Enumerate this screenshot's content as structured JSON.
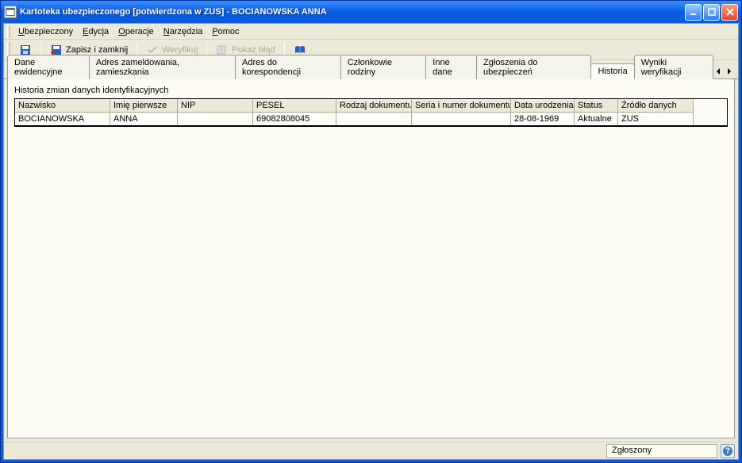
{
  "window": {
    "title": "Kartoteka ubezpieczonego [potwierdzona w ZUS] - BOCIANOWSKA ANNA"
  },
  "menu": {
    "ubezpieczony": "Ubezpieczony",
    "edycja": "Edycja",
    "operacje": "Operacje",
    "narzedzia": "Narzędzia",
    "pomoc": "Pomoc"
  },
  "toolbar": {
    "zapisz_i_zamknij": "Zapisz i zamknij",
    "weryfikuj": "Weryfikuj",
    "pokaz_blad": "Pokaż błąd"
  },
  "tabs": {
    "dane_ewidencyjne": "Dane ewidencyjne",
    "adres_zameldowania": "Adres zameldowania, zamieszkania",
    "adres_korespondencji": "Adres do korespondencji",
    "czlonkowie_rodziny": "Członkowie rodziny",
    "inne_dane": "Inne dane",
    "zgloszenia": "Zgłoszenia do ubezpieczeń",
    "historia": "Historia",
    "wyniki_weryfikacji": "Wyniki weryfikacji"
  },
  "section": {
    "title": "Historia zmian danych identyfikacyjnych"
  },
  "grid": {
    "headers": {
      "nazwisko": "Nazwisko",
      "imie": "Imię pierwsze",
      "nip": "NIP",
      "pesel": "PESEL",
      "rodzaj": "Rodzaj dokumentu",
      "seria": "Seria i numer dokumentu",
      "data": "Data urodzenia",
      "status": "Status",
      "zrodlo": "Źródło danych"
    },
    "rows": [
      {
        "nazwisko": "BOCIANOWSKA",
        "imie": "ANNA",
        "nip": "",
        "pesel": "69082808045",
        "rodzaj": "",
        "seria": "",
        "data": "28-08-1969",
        "status": "Aktualne",
        "zrodlo": "ZUS"
      }
    ]
  },
  "status": {
    "text": "Zgłoszony"
  }
}
